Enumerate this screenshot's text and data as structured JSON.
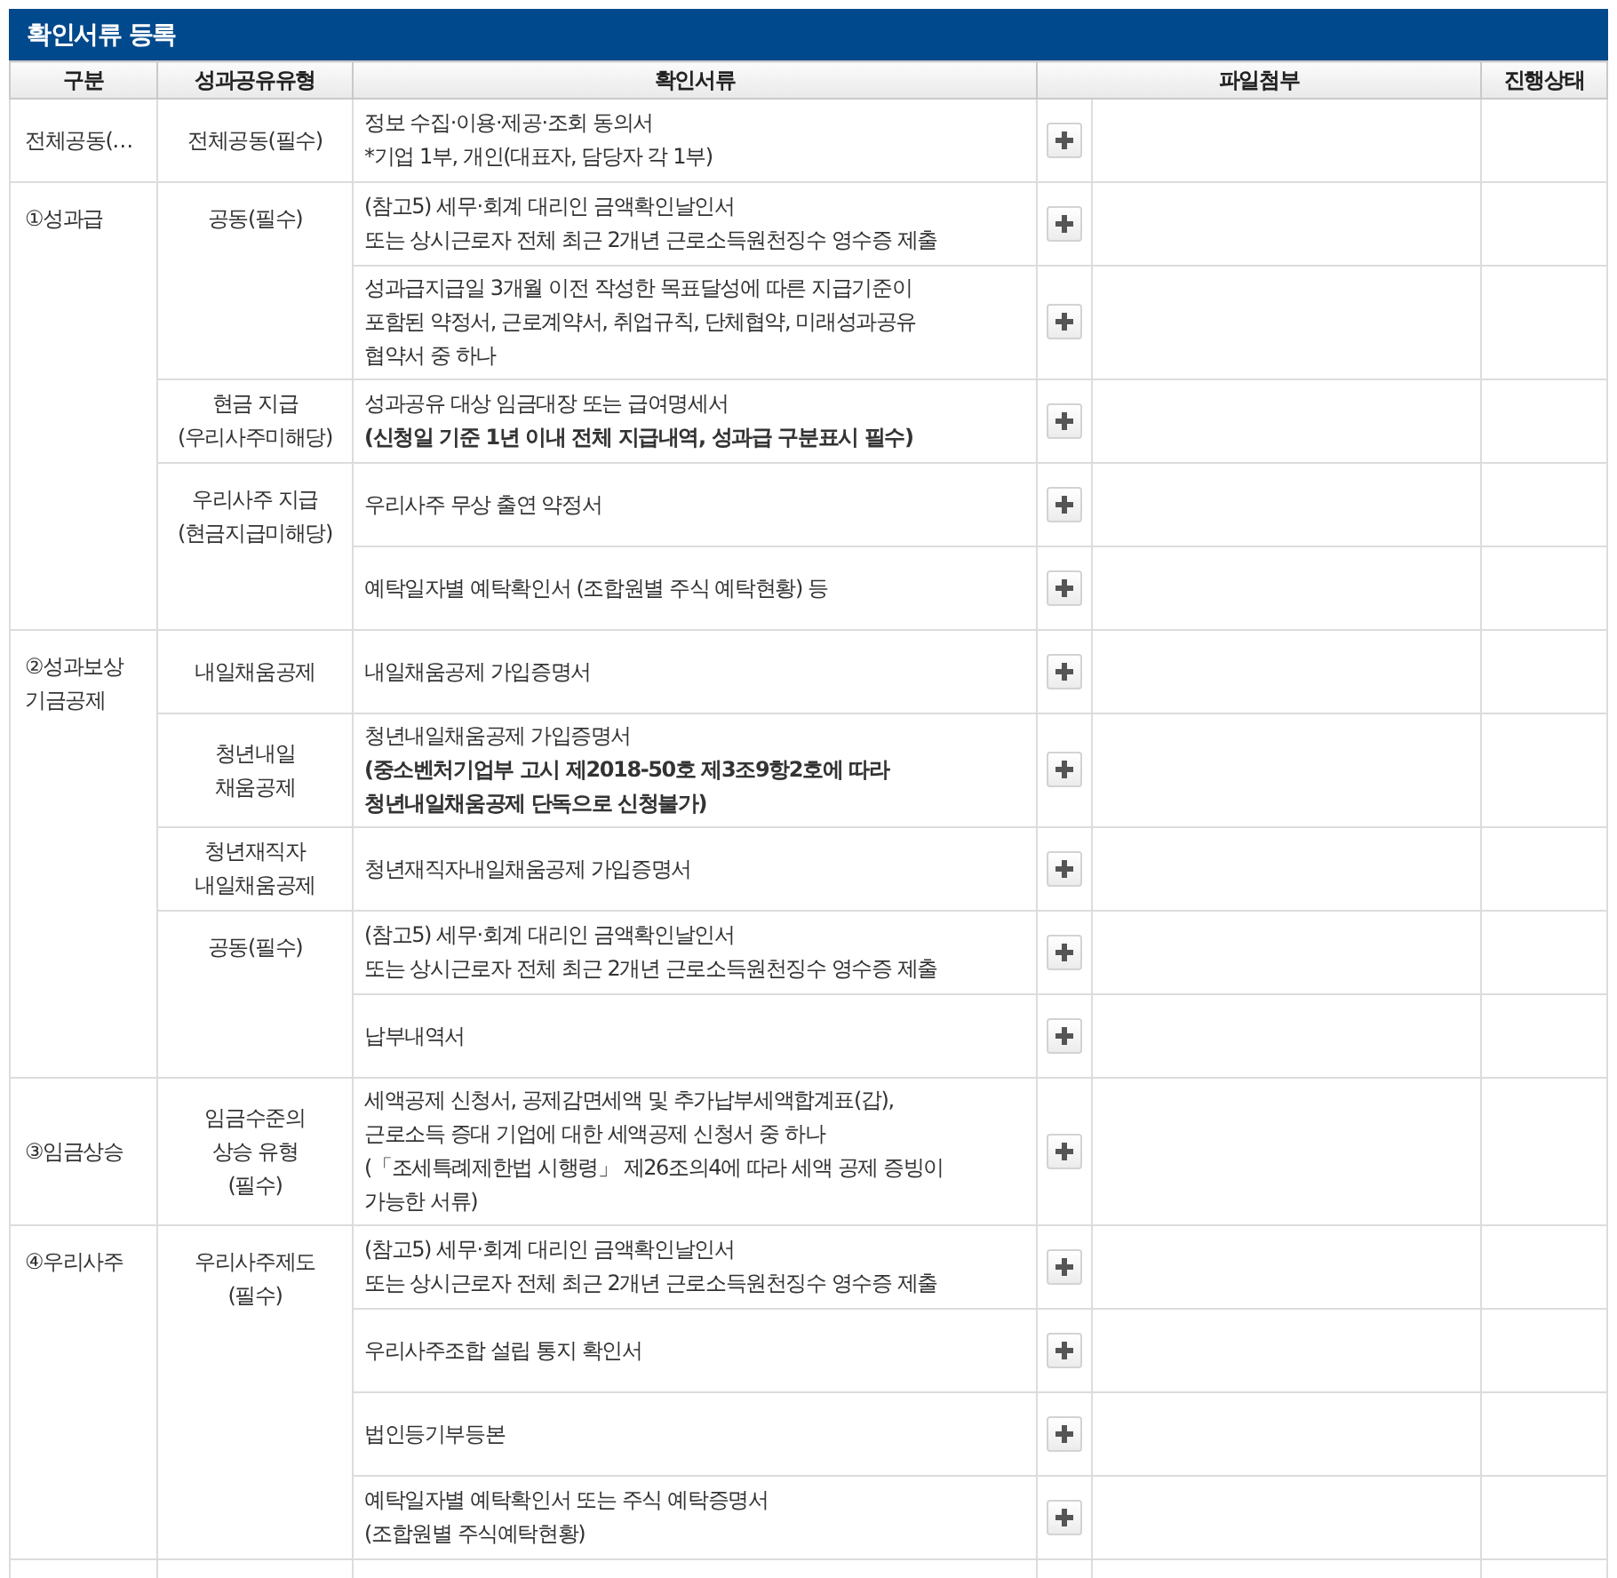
{
  "title": "확인서류 등록",
  "columns": [
    "구분",
    "성과공유유형",
    "확인서류",
    "파일첨부",
    "진행상태"
  ],
  "groups": [
    {
      "category": "전체공동(…",
      "types": [
        {
          "name": "전체공동(필수)",
          "docs": [
            "정보 수집·이용·제공·조회 동의서\n*기업 1부, 개인(대표자, 담당자 각 1부)"
          ]
        }
      ]
    },
    {
      "category": "①성과급",
      "types": [
        {
          "name": "공동(필수)",
          "docs": [
            "(참고5) 세무·회계 대리인 금액확인날인서\n또는 상시근로자 전체 최근 2개년 근로소득원천징수 영수증 제출",
            "성과급지급일 3개월 이전 작성한 목표달성에 따른 지급기준이\n포함된 약정서, 근로계약서, 취업규칙, 단체협약, 미래성과공유\n협약서 중 하나"
          ]
        },
        {
          "name": "현금 지급\n(우리사주미해당)",
          "docs": [
            "성과공유 대상 임금대장 또는 급여명세서\n**(신청일 기준 1년 이내 전체 지급내역, 성과급 구분표시 필수)**"
          ]
        },
        {
          "name": "우리사주 지급\n(현금지급미해당)",
          "docs": [
            "우리사주 무상 출연 약정서",
            "예탁일자별 예탁확인서 (조합원별 주식 예탁현황) 등"
          ]
        }
      ]
    },
    {
      "category": "②성과보상\n기금공제",
      "types": [
        {
          "name": "내일채움공제",
          "docs": [
            "내일채움공제 가입증명서"
          ]
        },
        {
          "name": "청년내일\n채움공제",
          "docs": [
            "청년내일채움공제 가입증명서\n**(중소벤처기업부 고시 제2018-50호 제3조9항2호에 따라\n청년내일채움공제 단독으로 신청불가)**"
          ]
        },
        {
          "name": "청년재직자\n내일채움공제",
          "docs": [
            "청년재직자내일채움공제 가입증명서"
          ]
        },
        {
          "name": "공동(필수)",
          "docs": [
            "(참고5) 세무·회계 대리인 금액확인날인서\n또는 상시근로자 전체 최근 2개년 근로소득원천징수 영수증 제출",
            "납부내역서"
          ]
        }
      ]
    },
    {
      "category": "③임금상승",
      "types": [
        {
          "name": "임금수준의\n상승 유형\n(필수)",
          "docs": [
            "세액공제 신청서, 공제감면세액 및 추가납부세액합계표(갑),\n근로소득 증대 기업에 대한 세액공제 신청서 중 하나\n(「조세특례제한법 시행령」 제26조의4에 따라 세액 공제 증빙이\n가능한 서류)"
          ]
        }
      ]
    },
    {
      "category": "④우리사주",
      "types": [
        {
          "name": "우리사주제도\n(필수)",
          "docs": [
            "(참고5) 세무·회계 대리인 금액확인날인서\n또는 상시근로자 전체 최근 2개년 근로소득원천징수 영수증 제출",
            "우리사주조합 설립 통지 확인서",
            "법인등기부등본",
            "예탁일자별 예탁확인서 또는 주식 예탁증명서\n(조합원별 주식예탁현황)"
          ]
        }
      ]
    }
  ]
}
